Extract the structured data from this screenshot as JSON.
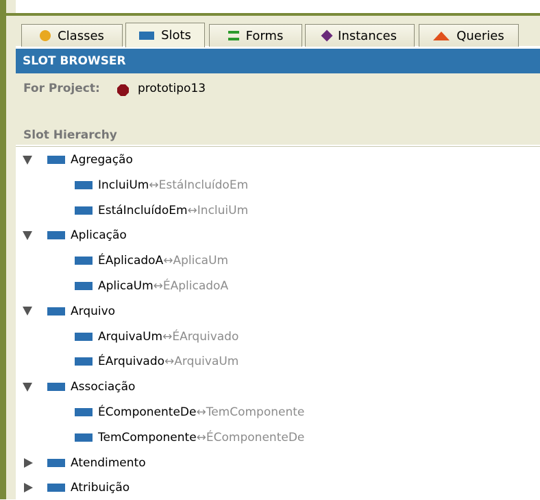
{
  "tabs": [
    {
      "label": "Classes",
      "icon": "classes-circle-icon"
    },
    {
      "label": "Slots",
      "icon": "slots-bar-icon"
    },
    {
      "label": "Forms",
      "icon": "forms-icon"
    },
    {
      "label": "Instances",
      "icon": "instances-diamond-icon"
    },
    {
      "label": "Queries",
      "icon": "queries-triangle-icon"
    }
  ],
  "header": {
    "title": "SLOT BROWSER"
  },
  "project": {
    "label": "For Project:",
    "name": "prototipo13"
  },
  "hierarchy": {
    "label": "Slot Hierarchy"
  },
  "tree": [
    {
      "name": "Agregação",
      "expanded": true,
      "children": [
        {
          "name": "IncluiUm",
          "inverse": "EstáIncluídoEm"
        },
        {
          "name": "EstáIncluídoEm",
          "inverse": "IncluiUm"
        }
      ]
    },
    {
      "name": "Aplicação",
      "expanded": true,
      "children": [
        {
          "name": "ÉAplicadoA",
          "inverse": "AplicaUm"
        },
        {
          "name": "AplicaUm",
          "inverse": "ÉAplicadoA"
        }
      ]
    },
    {
      "name": "Arquivo",
      "expanded": true,
      "children": [
        {
          "name": "ArquivaUm",
          "inverse": "ÉArquivado"
        },
        {
          "name": "ÉArquivado",
          "inverse": "ArquivaUm"
        }
      ]
    },
    {
      "name": "Associação",
      "expanded": true,
      "children": [
        {
          "name": "ÉComponenteDe",
          "inverse": "TemComponente"
        },
        {
          "name": "TemComponente",
          "inverse": "ÉComponenteDe"
        }
      ]
    },
    {
      "name": "Atendimento",
      "expanded": false,
      "children": []
    },
    {
      "name": "Atribuição",
      "expanded": false,
      "children": []
    }
  ],
  "colors": {
    "header_bg": "#2e74ad",
    "slot_icon": "#2b6fb0",
    "project_icon": "#8a0f1a"
  }
}
